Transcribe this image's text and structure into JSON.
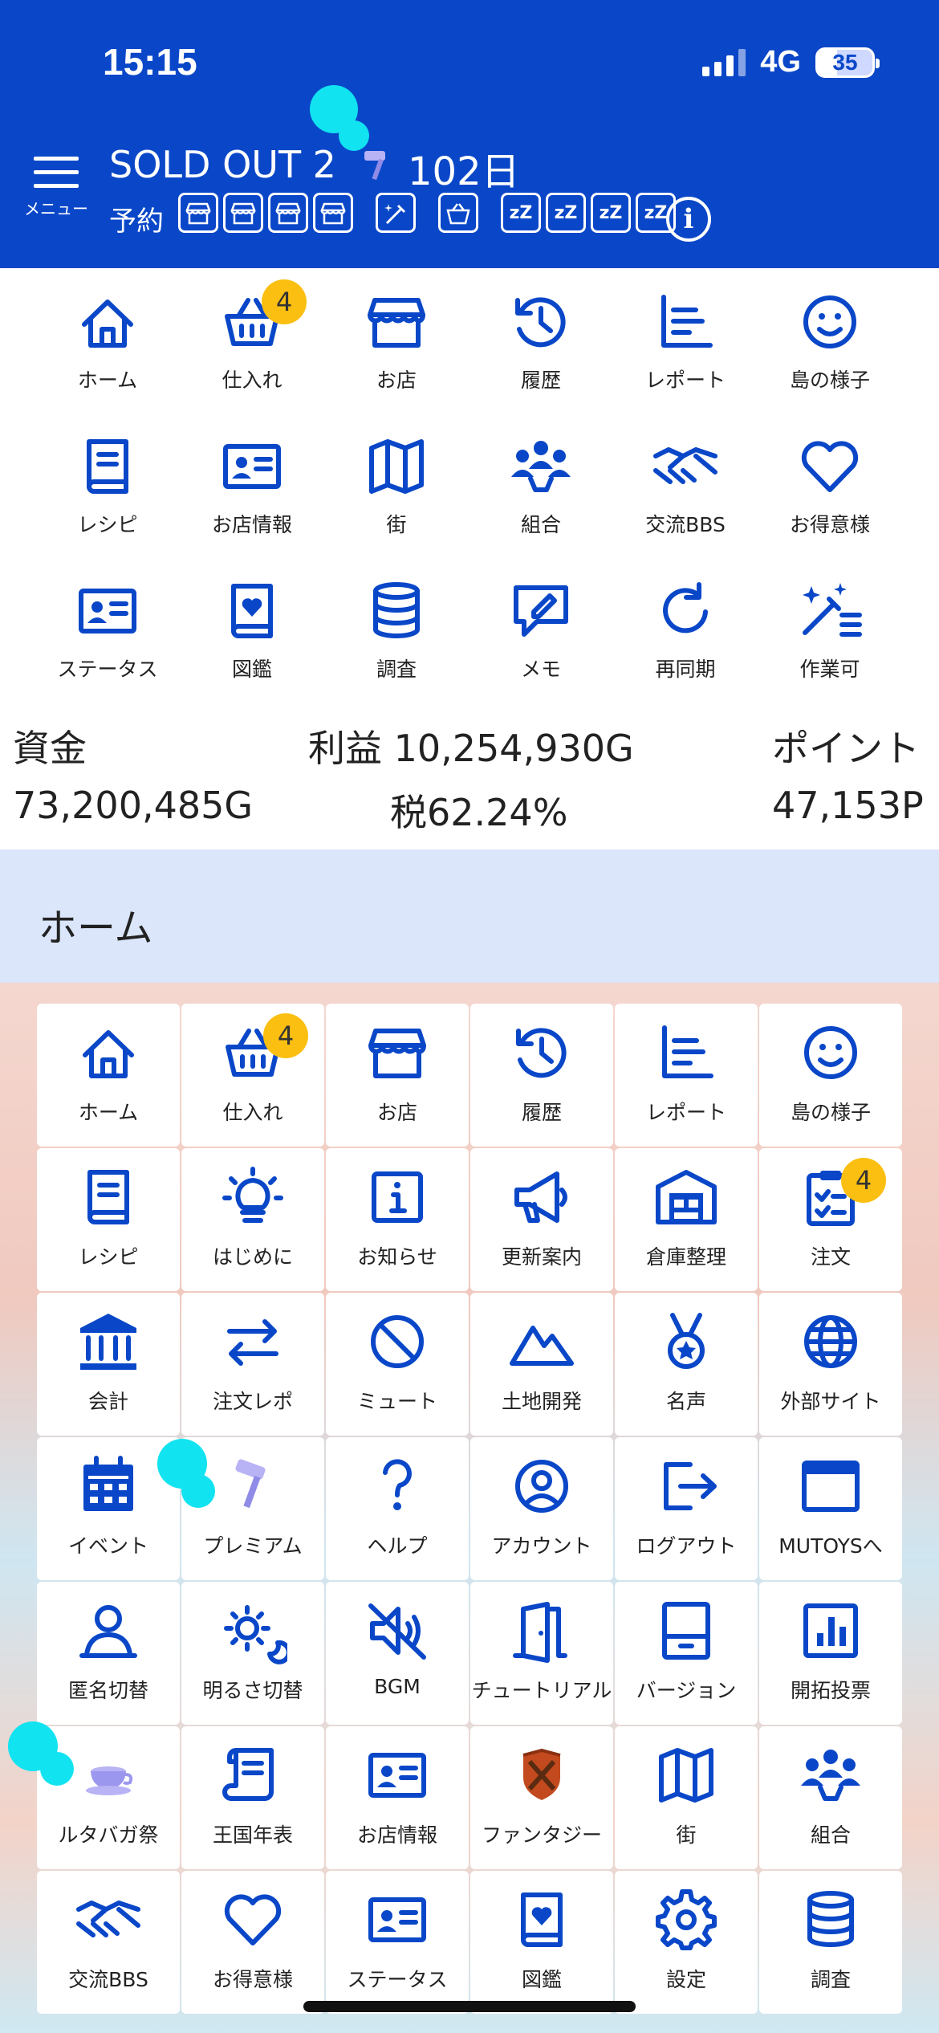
{
  "status_bar": {
    "time": "15:15",
    "network": "4G",
    "battery": "35"
  },
  "header": {
    "menu_label": "メニュー",
    "title": "SOLD OUT 2",
    "days": "102日",
    "reserve_label": "予約",
    "reserve_icons": [
      "shop-icon",
      "shop-icon",
      "shop-icon",
      "shop-icon",
      "wand-icon",
      "basket-icon",
      "sleep-icon",
      "sleep-icon",
      "sleep-icon",
      "sleep-icon"
    ],
    "sleep_text": "zZ"
  },
  "quick_grid": [
    {
      "label": "ホーム",
      "icon": "home-icon"
    },
    {
      "label": "仕入れ",
      "icon": "basket-icon",
      "badge": "4"
    },
    {
      "label": "お店",
      "icon": "shop-icon"
    },
    {
      "label": "履歴",
      "icon": "history-icon"
    },
    {
      "label": "レポート",
      "icon": "report-icon"
    },
    {
      "label": "島の様子",
      "icon": "smile-icon"
    },
    {
      "label": "レシピ",
      "icon": "book-icon"
    },
    {
      "label": "お店情報",
      "icon": "id-card-icon"
    },
    {
      "label": "街",
      "icon": "map-icon"
    },
    {
      "label": "組合",
      "icon": "group-icon"
    },
    {
      "label": "交流BBS",
      "icon": "handshake-icon"
    },
    {
      "label": "お得意様",
      "icon": "heart-icon"
    },
    {
      "label": "ステータス",
      "icon": "id-card-icon"
    },
    {
      "label": "図鑑",
      "icon": "heart-book-icon"
    },
    {
      "label": "調査",
      "icon": "database-icon"
    },
    {
      "label": "メモ",
      "icon": "memo-icon"
    },
    {
      "label": "再同期",
      "icon": "refresh-icon"
    },
    {
      "label": "作業可",
      "icon": "wand-list-icon"
    }
  ],
  "money": {
    "funds_label": "資金",
    "funds_value": "73,200,485G",
    "profit": "利益 10,254,930G",
    "tax": "税62.24%",
    "points_label": "ポイント",
    "points_value": "47,153P"
  },
  "section_title": "ホーム",
  "home_grid": [
    {
      "label": "ホーム",
      "icon": "home-icon"
    },
    {
      "label": "仕入れ",
      "icon": "basket-icon",
      "badge": "4"
    },
    {
      "label": "お店",
      "icon": "shop-icon"
    },
    {
      "label": "履歴",
      "icon": "history-icon"
    },
    {
      "label": "レポート",
      "icon": "report-icon"
    },
    {
      "label": "島の様子",
      "icon": "smile-icon"
    },
    {
      "label": "レシピ",
      "icon": "book-icon"
    },
    {
      "label": "はじめに",
      "icon": "bulb-icon"
    },
    {
      "label": "お知らせ",
      "icon": "info-icon"
    },
    {
      "label": "更新案内",
      "icon": "megaphone-icon"
    },
    {
      "label": "倉庫整理",
      "icon": "warehouse-icon"
    },
    {
      "label": "注文",
      "icon": "clipboard-icon",
      "badge": "4"
    },
    {
      "label": "会計",
      "icon": "bank-icon"
    },
    {
      "label": "注文レポ",
      "icon": "swap-icon"
    },
    {
      "label": "ミュート",
      "icon": "block-icon"
    },
    {
      "label": "土地開発",
      "icon": "mountain-icon"
    },
    {
      "label": "名声",
      "icon": "medal-icon"
    },
    {
      "label": "外部サイト",
      "icon": "globe-icon"
    },
    {
      "label": "イベント",
      "icon": "calendar-icon"
    },
    {
      "label": "プレミアム",
      "icon": "hammer-icon"
    },
    {
      "label": "ヘルプ",
      "icon": "question-icon"
    },
    {
      "label": "アカウント",
      "icon": "account-icon"
    },
    {
      "label": "ログアウト",
      "icon": "logout-icon"
    },
    {
      "label": "MUTOYSへ",
      "icon": "window-icon"
    },
    {
      "label": "匿名切替",
      "icon": "person-icon"
    },
    {
      "label": "明るさ切替",
      "icon": "brightness-icon"
    },
    {
      "label": "BGM",
      "icon": "mute-icon"
    },
    {
      "label": "チュートリアル",
      "icon": "door-icon"
    },
    {
      "label": "バージョン",
      "icon": "tablet-icon"
    },
    {
      "label": "開拓投票",
      "icon": "chart-icon"
    },
    {
      "label": "ルタバガ祭",
      "icon": "teacup-icon"
    },
    {
      "label": "王国年表",
      "icon": "scroll-icon"
    },
    {
      "label": "お店情報",
      "icon": "id-card-icon"
    },
    {
      "label": "ファンタジー",
      "icon": "shield-icon"
    },
    {
      "label": "街",
      "icon": "map-icon"
    },
    {
      "label": "組合",
      "icon": "group-icon"
    },
    {
      "label": "交流BBS",
      "icon": "handshake-icon"
    },
    {
      "label": "お得意様",
      "icon": "heart-icon"
    },
    {
      "label": "ステータス",
      "icon": "id-card-icon"
    },
    {
      "label": "図鑑",
      "icon": "heart-book-icon"
    },
    {
      "label": "設定",
      "icon": "gear-icon"
    },
    {
      "label": "調査",
      "icon": "database-icon"
    }
  ]
}
